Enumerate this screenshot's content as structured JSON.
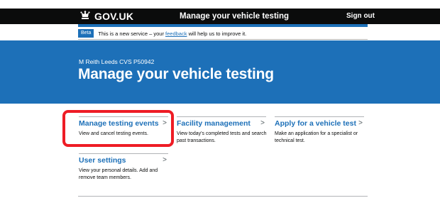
{
  "header": {
    "logo_text": "GOV.UK",
    "service_name": "Manage your vehicle testing",
    "sign_out": "Sign out"
  },
  "phase_banner": {
    "tag": "Beta",
    "text_before": "This is a new service – your ",
    "link": "feedback",
    "text_after": " will help us to improve it."
  },
  "hero": {
    "caption": "M Reith Leeds CVS P50942",
    "title": "Manage your vehicle testing"
  },
  "cards": [
    {
      "title": "Manage testing events",
      "description": "View and cancel testing events."
    },
    {
      "title": "Facility management",
      "description": "View today's completed tests and search past transactions."
    },
    {
      "title": "Apply for a vehicle test",
      "description": "Make an application for a specialist or technical test."
    },
    {
      "title": "User settings",
      "description": "View your personal details. Add and remove team members."
    }
  ],
  "card_arrow": ">",
  "colors": {
    "brand_blue": "#1d70b8",
    "header_black": "#0b0c0c",
    "highlight_red": "#ee1c25"
  }
}
